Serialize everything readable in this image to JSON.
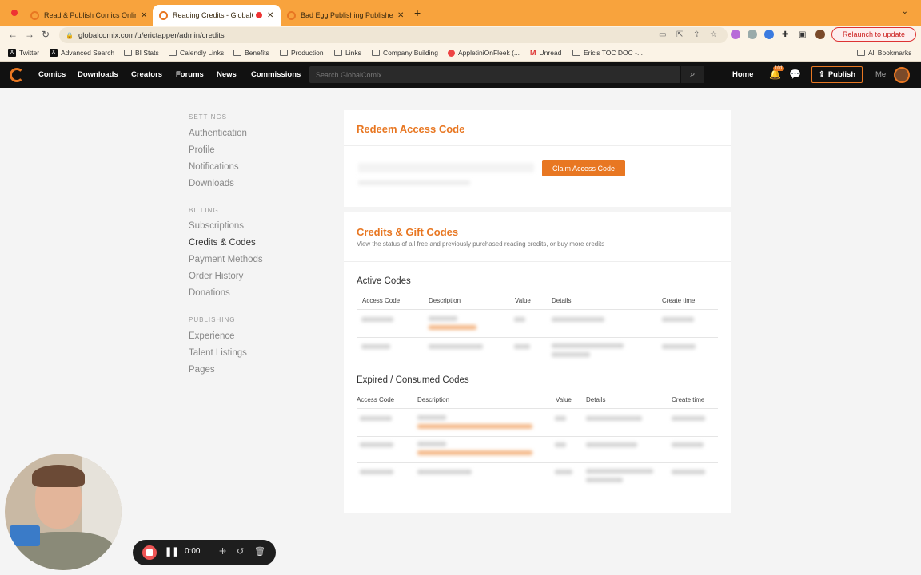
{
  "browser": {
    "tabs": [
      {
        "label": "Read & Publish Comics Online",
        "active": false
      },
      {
        "label": "Reading Credits - GlobalComix",
        "active": true
      },
      {
        "label": "Bad Egg Publishing Publisher",
        "active": false
      }
    ],
    "url": "globalcomix.com/u/erictapper/admin/credits",
    "relaunch_label": "Relaunch to update",
    "bookmarks": [
      "Twitter",
      "Advanced Search",
      "BI Stats",
      "Calendly Links",
      "Benefits",
      "Production",
      "Links",
      "Company Building",
      "AppletiniOnFleek (...",
      "Unread",
      "Eric's TOC DOC -...",
      "All Bookmarks"
    ]
  },
  "site": {
    "nav": [
      "Comics",
      "Downloads",
      "Creators",
      "Forums",
      "News",
      "Commissions"
    ],
    "search_placeholder": "Search GlobalComix",
    "home_label": "Home",
    "notification_count": "101",
    "publish_label": "Publish",
    "me_label": "Me"
  },
  "sidebar": {
    "settings_title": "SETTINGS",
    "settings": [
      "Authentication",
      "Profile",
      "Notifications",
      "Downloads"
    ],
    "billing_title": "BILLING",
    "billing": [
      "Subscriptions",
      "Credits & Codes",
      "Payment Methods",
      "Order History",
      "Donations"
    ],
    "active_item": "Credits & Codes",
    "publishing_title": "PUBLISHING",
    "publishing": [
      "Experience",
      "Talent Listings",
      "Pages"
    ]
  },
  "redeem": {
    "title": "Redeem Access Code",
    "button_label": "Claim Access Code"
  },
  "credits": {
    "title": "Credits & Gift Codes",
    "subtitle": "View the status of all free and previously purchased reading credits, or buy more credits",
    "active_title": "Active Codes",
    "active_columns": [
      "Access Code",
      "Description",
      "Value",
      "Details",
      "Create time"
    ],
    "expired_title": "Expired / Consumed Codes",
    "expired_columns": [
      "Access Code",
      "Description",
      "Value",
      "Details",
      "Create time"
    ]
  },
  "recorder": {
    "time": "0:00"
  },
  "colors": {
    "accent": "#e87722",
    "tabstrip": "#f8a33d",
    "navbar": "#111111"
  }
}
